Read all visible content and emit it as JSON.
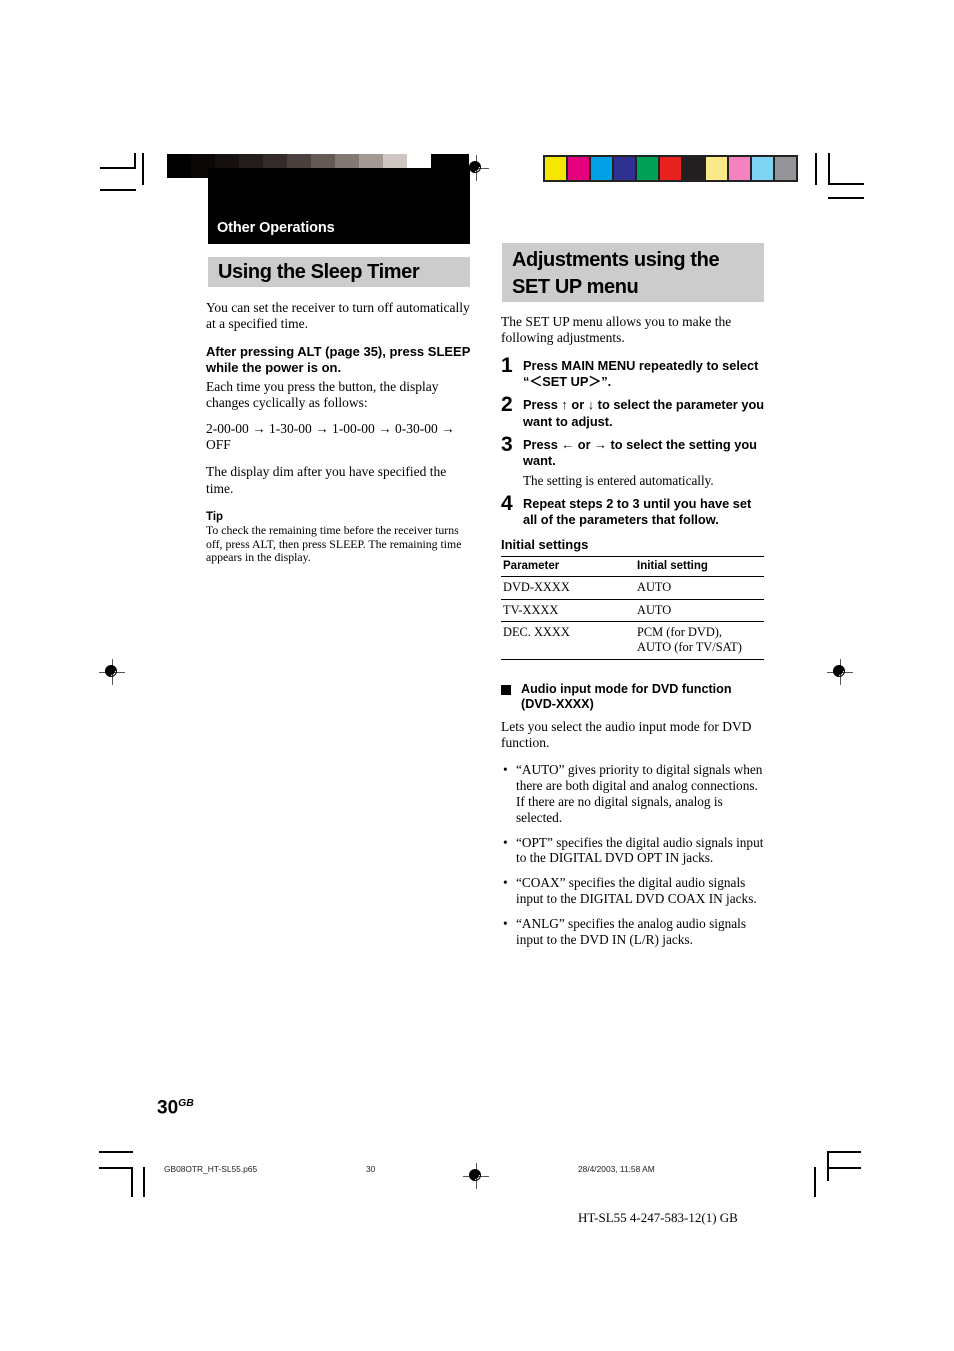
{
  "document": {
    "chapter_label": "Other Operations",
    "page_number": "30",
    "page_number_suffix": "GB"
  },
  "color_bars": {
    "grayscale": [
      "#000000",
      "#0b0707",
      "#161110",
      "#231d1b",
      "#332b29",
      "#4b403d",
      "#655955",
      "#837874",
      "#a39a96",
      "#cec6c2",
      "#ffffff"
    ],
    "colors": [
      "#f5e600",
      "#e5007e",
      "#00a0e4",
      "#2e3192",
      "#00a157",
      "#e8231f",
      "#231f20",
      "#fbe98a",
      "#f481c0",
      "#7fd4f4",
      "#939598"
    ]
  },
  "left_column": {
    "heading": "Using the Sleep Timer",
    "intro": "You can set the receiver to turn off automatically at a specified time.",
    "bold_lead": "After pressing ALT (page 35), press SLEEP while the power is on.",
    "para_after_lead": "Each time you press the button, the display changes cyclically as follows:",
    "sequence": "2-00-00 → 1-30-00 → 1-00-00 → 0-30-00 → OFF",
    "para_dim": "The display dim after you have specified the time.",
    "tip_label": "Tip",
    "tip_body": "To check the remaining time before the receiver turns off, press ALT, then press SLEEP. The remaining time appears in the display."
  },
  "right_column": {
    "heading_line1": "Adjustments using the",
    "heading_line2": "SET UP menu",
    "intro": "The SET UP menu allows you to make the following adjustments.",
    "steps": [
      {
        "num": "1",
        "text": "Press MAIN MENU repeatedly to select “＜SET UP＞”.",
        "sub": ""
      },
      {
        "num": "2",
        "text": "Press ↑ or ↓ to select the parameter you want to adjust.",
        "sub": ""
      },
      {
        "num": "3",
        "text": "Press ← or → to select the setting you want.",
        "sub": "The setting is entered automatically."
      },
      {
        "num": "4",
        "text": "Repeat steps 2 to 3 until you have set all of the parameters that follow.",
        "sub": ""
      }
    ],
    "table_title": "Initial settings",
    "table": {
      "headers": [
        "Parameter",
        "Initial setting"
      ],
      "rows": [
        [
          "DVD-XXXX",
          "AUTO"
        ],
        [
          "TV-XXXX",
          "AUTO"
        ],
        [
          "DEC. XXXX",
          "PCM (for DVD),\nAUTO (for TV/SAT)"
        ]
      ]
    },
    "section": {
      "heading": "Audio input mode for DVD function (DVD-XXXX)",
      "intro": "Lets you select the audio input mode for DVD function.",
      "bullets": [
        "“AUTO” gives priority to digital signals when there are both digital and analog connections. If there are no digital signals, analog is selected.",
        "“OPT” specifies the digital audio signals input to the DIGITAL DVD OPT IN jacks.",
        "“COAX” specifies the digital audio signals input to the DIGITAL DVD COAX IN jacks.",
        "“ANLG” specifies the analog audio signals input to the DVD IN (L/R) jacks."
      ]
    }
  },
  "footer": {
    "filename": "GB08OTR_HT-SL55.p65",
    "page": "30",
    "timestamp": "28/4/2003, 11:58 AM",
    "colophon": "HT-SL55    4-247-583-12(1) GB"
  }
}
